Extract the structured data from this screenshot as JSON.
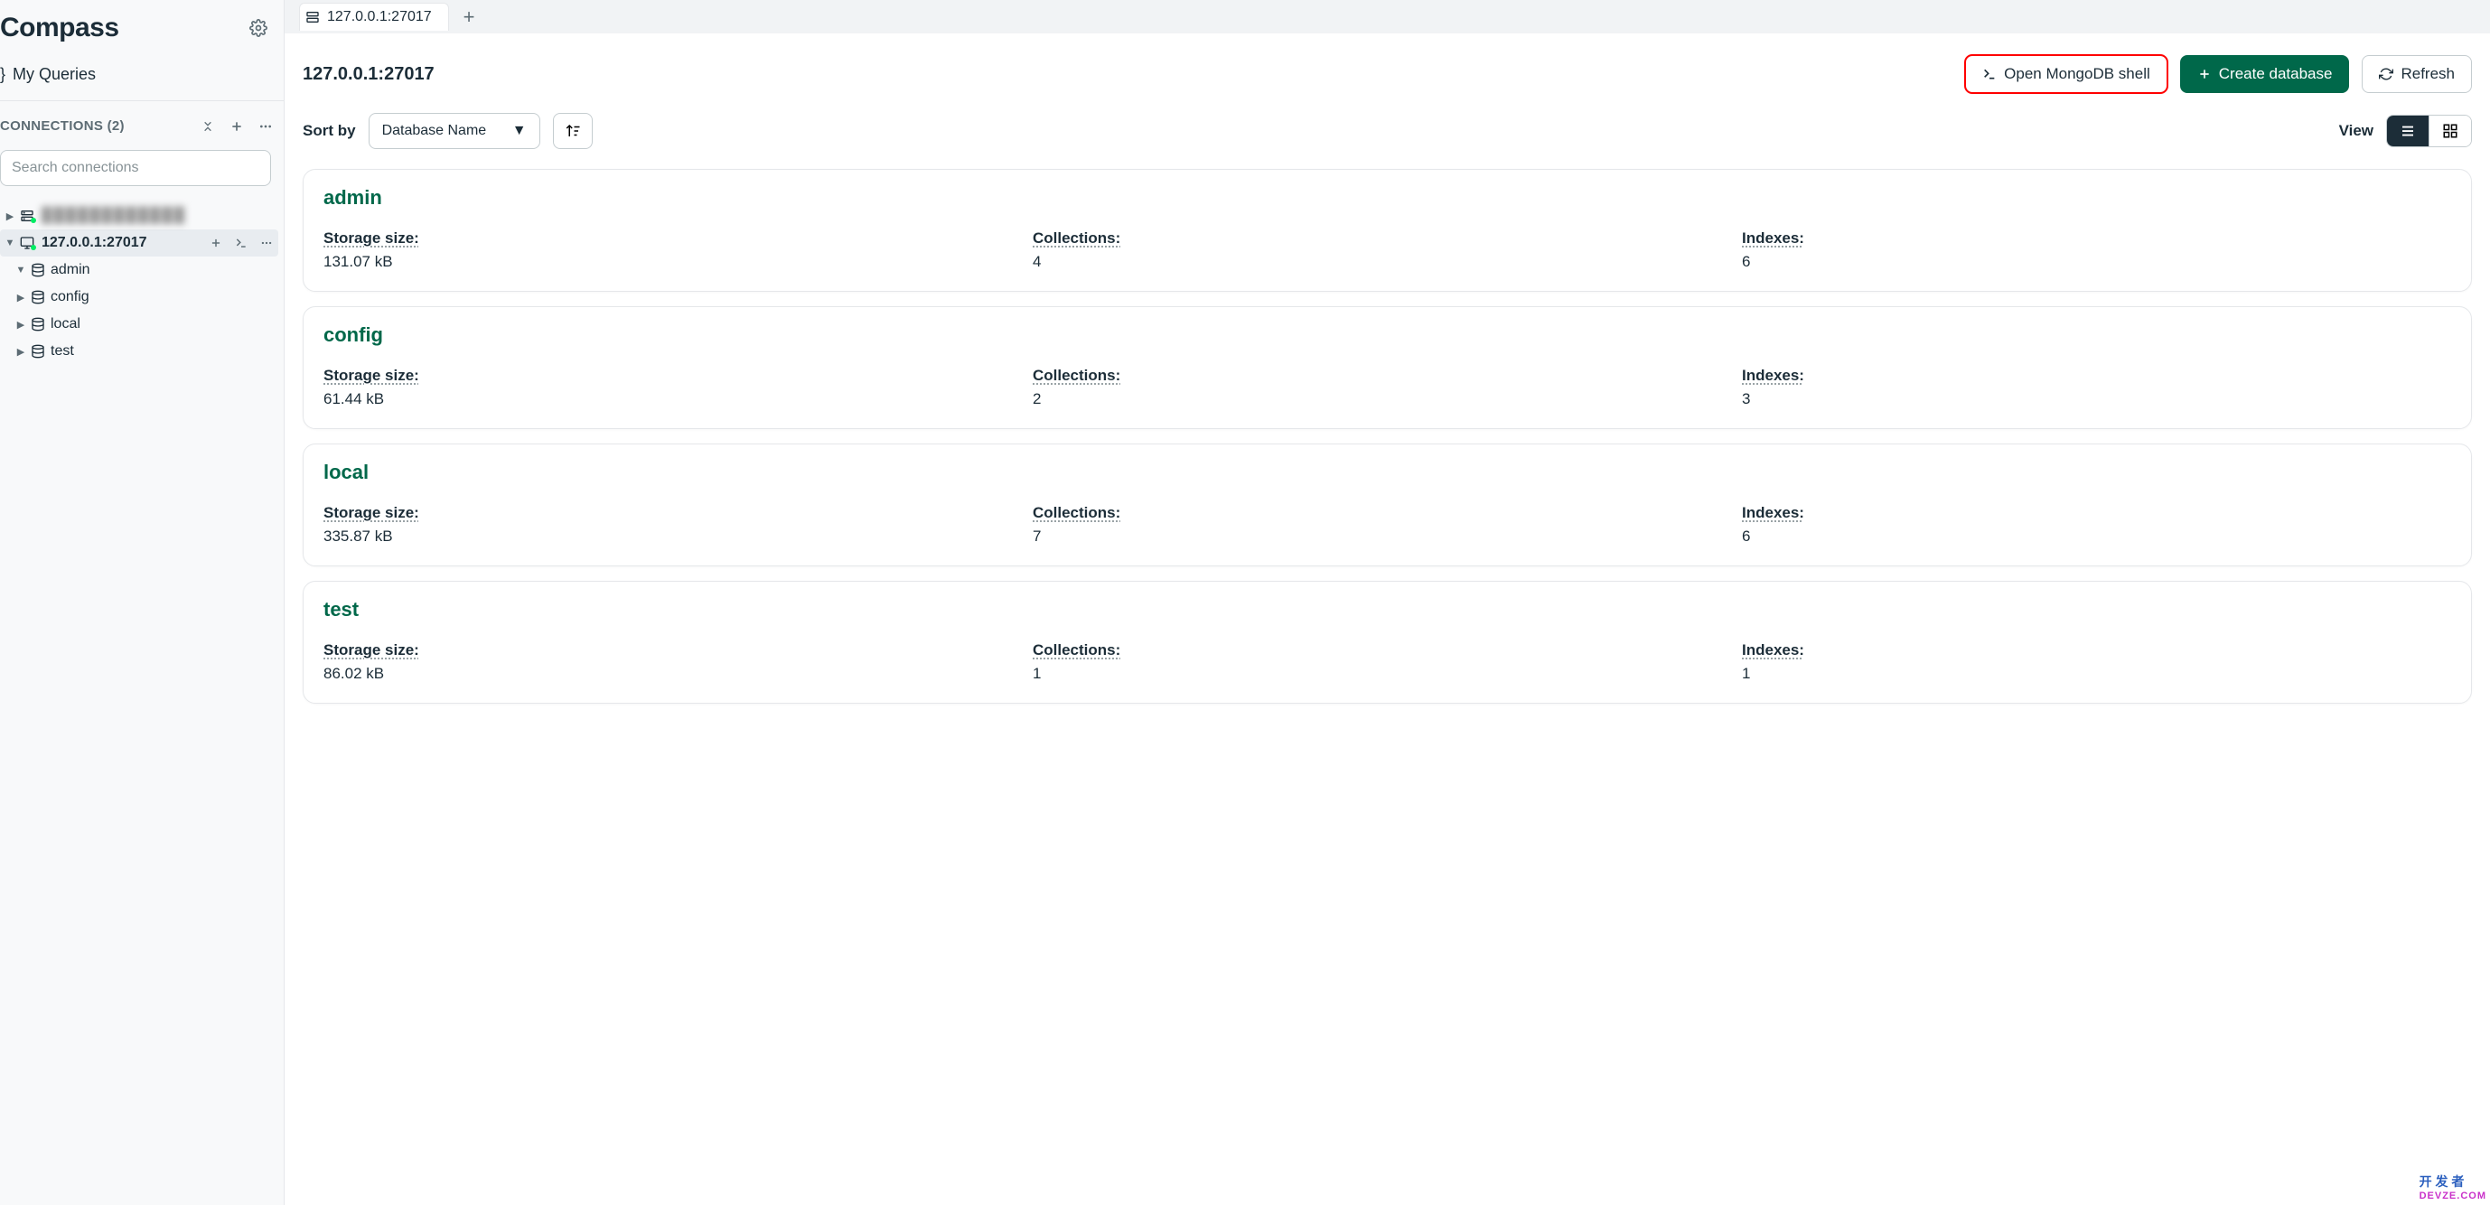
{
  "app": {
    "title": "Compass"
  },
  "sidebar": {
    "my_queries": "My Queries",
    "connections_label": "CONNECTIONS",
    "connections_count": "(2)",
    "search_placeholder": "Search connections",
    "items": [
      {
        "label_obscured": true,
        "expanded": false
      },
      {
        "label": "127.0.0.1:27017",
        "expanded": true,
        "active": true,
        "children": [
          {
            "label": "admin",
            "expanded": true
          },
          {
            "label": "config",
            "expanded": false
          },
          {
            "label": "local",
            "expanded": false
          },
          {
            "label": "test",
            "expanded": false
          }
        ]
      }
    ]
  },
  "tabs": {
    "items": [
      {
        "label": "127.0.0.1:27017"
      }
    ]
  },
  "header": {
    "connection_title": "127.0.0.1:27017",
    "open_shell": "Open MongoDB shell",
    "create_db": "Create database",
    "refresh": "Refresh"
  },
  "sort": {
    "label": "Sort by",
    "selected": "Database Name"
  },
  "view": {
    "label": "View"
  },
  "stat_labels": {
    "storage": "Storage size:",
    "collections": "Collections:",
    "indexes": "Indexes:"
  },
  "databases": [
    {
      "name": "admin",
      "storage": "131.07 kB",
      "collections": "4",
      "indexes": "6"
    },
    {
      "name": "config",
      "storage": "61.44 kB",
      "collections": "2",
      "indexes": "3"
    },
    {
      "name": "local",
      "storage": "335.87 kB",
      "collections": "7",
      "indexes": "6"
    },
    {
      "name": "test",
      "storage": "86.02 kB",
      "collections": "1",
      "indexes": "1"
    }
  ],
  "watermark": {
    "line1": "开 发 者",
    "line2": "DEVZE.COM"
  }
}
